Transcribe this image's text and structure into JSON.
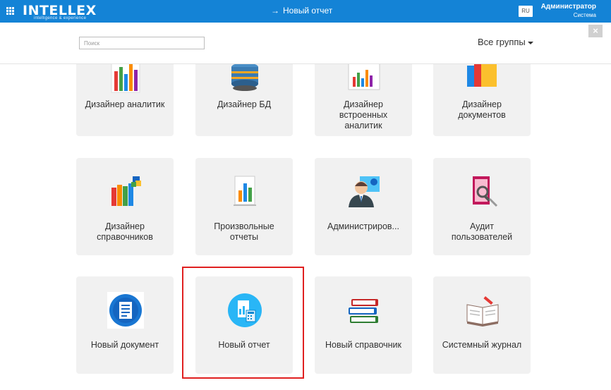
{
  "topbar": {
    "logo": "INTELLEX",
    "logo_tagline": "intelligence & experience",
    "breadcrumb_arrow": "→",
    "breadcrumb": "Новый отчет",
    "language": "RU",
    "user_name": "Администратор",
    "user_role": "Система",
    "close_symbol": "×"
  },
  "toolbar": {
    "search_placeholder": "Поиск",
    "groups_label": "Все группы"
  },
  "tiles": [
    {
      "label": "Дизайнер аналитик",
      "icon": "bar-chart-icon"
    },
    {
      "label": "Дизайнер БД",
      "icon": "database-icon"
    },
    {
      "label": "Дизайнер встроенных аналитик",
      "icon": "embedded-chart-icon"
    },
    {
      "label": "Дизайнер документов",
      "icon": "folders-icon"
    },
    {
      "label": "Дизайнер справочников",
      "icon": "books-icon"
    },
    {
      "label": "Произвольные отчеты",
      "icon": "report-chart-icon"
    },
    {
      "label": "Администриров...",
      "icon": "admin-user-icon"
    },
    {
      "label": "Аудит пользователей",
      "icon": "audit-icon"
    },
    {
      "label": "Новый документ",
      "icon": "document-circle-icon"
    },
    {
      "label": "Новый отчет",
      "icon": "report-calculator-icon"
    },
    {
      "label": "Новый справочник",
      "icon": "book-stack-icon"
    },
    {
      "label": "Системный журнал",
      "icon": "journal-icon"
    }
  ],
  "highlighted_tile": "Новый отчет",
  "colors": {
    "topbar": "#1483d6",
    "tile_bg": "#f1f1f1",
    "highlight": "#e02020"
  }
}
